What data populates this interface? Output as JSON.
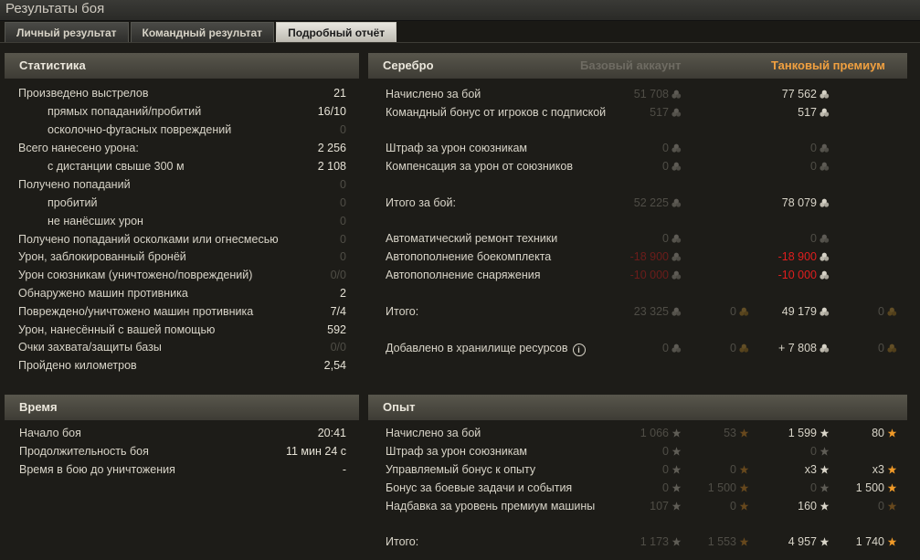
{
  "window": {
    "title": "Результаты боя"
  },
  "tabs": [
    {
      "label": "Личный результат"
    },
    {
      "label": "Командный результат"
    },
    {
      "label": "Подробный отчёт"
    }
  ],
  "stats": {
    "title": "Статистика",
    "rows": [
      {
        "label": "Произведено выстрелов",
        "value": "21"
      },
      {
        "label": "прямых попаданий/пробитий",
        "value": "16/10"
      },
      {
        "label": "осколочно-фугасных повреждений",
        "value": "0"
      },
      {
        "label": "Всего нанесено урона:",
        "value": "2 256"
      },
      {
        "label": "с дистанции свыше 300 м",
        "value": "2 108"
      },
      {
        "label": "Получено попаданий",
        "value": "0"
      },
      {
        "label": "пробитий",
        "value": "0"
      },
      {
        "label": "не нанёсших урон",
        "value": "0"
      },
      {
        "label": "Получено попаданий осколками или огнесмесью",
        "value": "0"
      },
      {
        "label": "Урон, заблокированный бронёй",
        "value": "0"
      },
      {
        "label": "Урон союзникам (уничтожено/повреждений)",
        "value": "0/0"
      },
      {
        "label": "Обнаружено машин противника",
        "value": "2"
      },
      {
        "label": "Повреждено/уничтожено машин противника",
        "value": "7/4"
      },
      {
        "label": "Урон, нанесённый с вашей помощью",
        "value": "592"
      },
      {
        "label": "Очки захвата/защиты базы",
        "value": "0/0"
      },
      {
        "label": "Пройдено километров",
        "value": "2,54"
      }
    ]
  },
  "time": {
    "title": "Время",
    "rows": [
      {
        "label": "Начало боя",
        "value": "20:41"
      },
      {
        "label": "Продолжительность боя",
        "value": "11 мин 24 с"
      },
      {
        "label": "Время в бою до уничтожения",
        "value": "-"
      }
    ]
  },
  "silver": {
    "title": "Серебро",
    "col_base": "Базовый аккаунт",
    "col_premium": "Танковый премиум",
    "rows": [
      {
        "label": "Начислено за бой",
        "base": "51 708",
        "prem": "77 562"
      },
      {
        "label": "Командный бонус от игроков с подпиской",
        "base": "517",
        "prem": "517"
      },
      {
        "label": "Штраф за урон союзникам",
        "base": "0",
        "prem": "0"
      },
      {
        "label": "Компенсация за урон от союзников",
        "base": "0",
        "prem": "0"
      },
      {
        "label": "Итого за бой:",
        "base": "52 225",
        "prem": "78 079"
      },
      {
        "label": "Автоматический ремонт техники",
        "base": "0",
        "prem": "0"
      },
      {
        "label": "Автопополнение боекомплекта",
        "base": "-18 900",
        "prem": "-18 900"
      },
      {
        "label": "Автопополнение снаряжения",
        "base": "-10 000",
        "prem": "-10 000"
      },
      {
        "label": "Итого:",
        "base": "23 325",
        "base2": "0",
        "prem": "49 179",
        "prem2": "0"
      },
      {
        "label": "Добавлено в хранилище ресурсов",
        "info": "i",
        "base": "0",
        "base2": "0",
        "prem": "+ 7 808",
        "prem2": "0"
      }
    ]
  },
  "xp": {
    "title": "Опыт",
    "rows": [
      {
        "label": "Начислено за бой",
        "base": "1 066",
        "base2": "53",
        "prem": "1 599",
        "prem2": "80"
      },
      {
        "label": "Штраф за урон союзникам",
        "base": "0",
        "prem": "0"
      },
      {
        "label": "Управляемый бонус к опыту",
        "base": "0",
        "base2": "0",
        "prem": "x3",
        "prem2": "x3"
      },
      {
        "label": "Бонус за боевые задачи и события",
        "base": "0",
        "base2": "1 500",
        "prem": "0",
        "prem2": "1 500"
      },
      {
        "label": "Надбавка за уровень премиум машины",
        "base": "107",
        "base2": "0",
        "prem": "160",
        "prem2": "0"
      },
      {
        "label": "Итого:",
        "base": "1 173",
        "base2": "1 553",
        "prem": "4 957",
        "prem2": "1 740"
      }
    ]
  },
  "icons": {
    "credits": "credits-icon",
    "gold": "gold-icon",
    "xp": "star-icon",
    "freexp": "free-xp-icon",
    "info": "info-icon"
  }
}
